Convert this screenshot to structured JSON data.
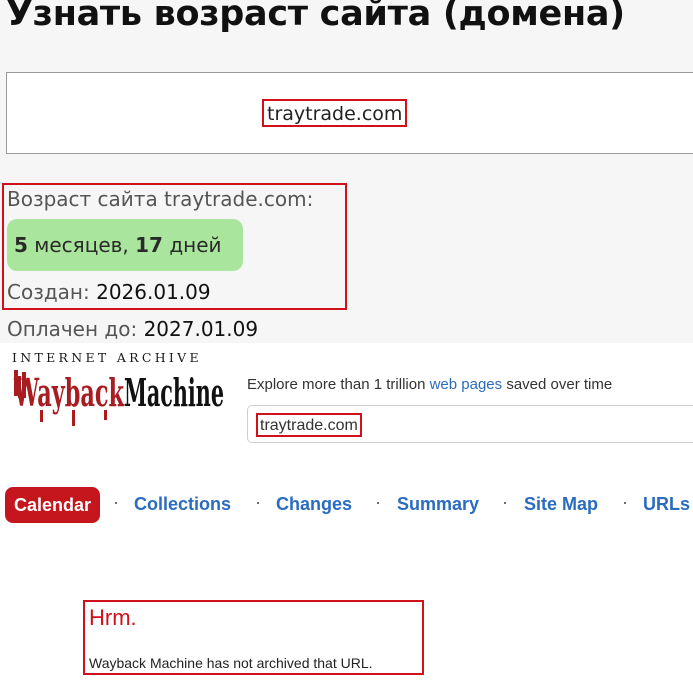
{
  "header": {
    "title": "Узнать возраст сайта (домена)"
  },
  "domain_input": {
    "value": "traytrade.com"
  },
  "result": {
    "age_label": "Возраст сайта traytrade.com:",
    "age_months_num": "5",
    "age_months_word": "месяцев,",
    "age_days_num": "17",
    "age_days_word": "дней",
    "created_label": "Создан:",
    "created_value": "2026.01.09",
    "paid_label": "Оплачен до:",
    "paid_value": "2027.01.09"
  },
  "wayback": {
    "ia_label": "INTERNET ARCHIVE",
    "logo_text_1": "Wayback",
    "logo_text_2": "Machine",
    "explore_prefix": "Explore more than 1 trillion",
    "explore_link": "web pages",
    "explore_suffix": "saved over time",
    "search_value": "traytrade.com",
    "nav": {
      "calendar": "Calendar",
      "collections": "Collections",
      "changes": "Changes",
      "summary": "Summary",
      "sitemap": "Site Map",
      "urls": "URLs",
      "separator": "·"
    },
    "error_title": "Hrm.",
    "error_message": "Wayback Machine has not archived that URL."
  },
  "colors": {
    "highlight_red": "#d0101a",
    "badge_green": "#a9e59c",
    "link_blue": "#2a6cbf",
    "calendar_red": "#c4161c",
    "logo_red": "#a81d22"
  }
}
